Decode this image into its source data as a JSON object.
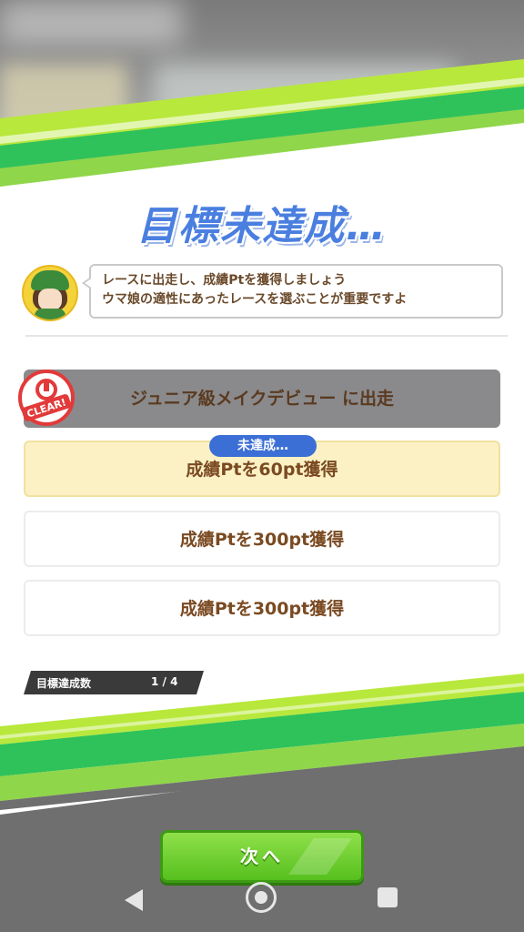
{
  "title": "目標未達成…",
  "message": {
    "line1": "レースに出走し、成績Ptを獲得しましょう",
    "line2": "ウマ娘の適性にあったレースを選ぶことが重要ですよ"
  },
  "goals": [
    {
      "text": "ジュニア級メイクデビュー に出走",
      "state": "cleared"
    },
    {
      "text": "成績Ptを60pt獲得",
      "state": "active"
    },
    {
      "text": "成績Ptを300pt獲得",
      "state": "pending"
    },
    {
      "text": "成績Ptを300pt獲得",
      "state": "pending"
    }
  ],
  "active_badge": "未達成…",
  "clear_stamp_text": "CLEAR!",
  "progress": {
    "label": "目標達成数",
    "value": "1 / 4"
  },
  "next_button": "次へ",
  "colors": {
    "accent_green": "#56c01e",
    "title_blue": "#4a7fe0",
    "badge_blue": "#3b6fd6",
    "text_brown": "#7a4a22"
  },
  "icons": [
    "character-avatar-icon",
    "clear-stamp-icon",
    "back-nav-icon",
    "home-nav-icon",
    "recents-nav-icon"
  ]
}
